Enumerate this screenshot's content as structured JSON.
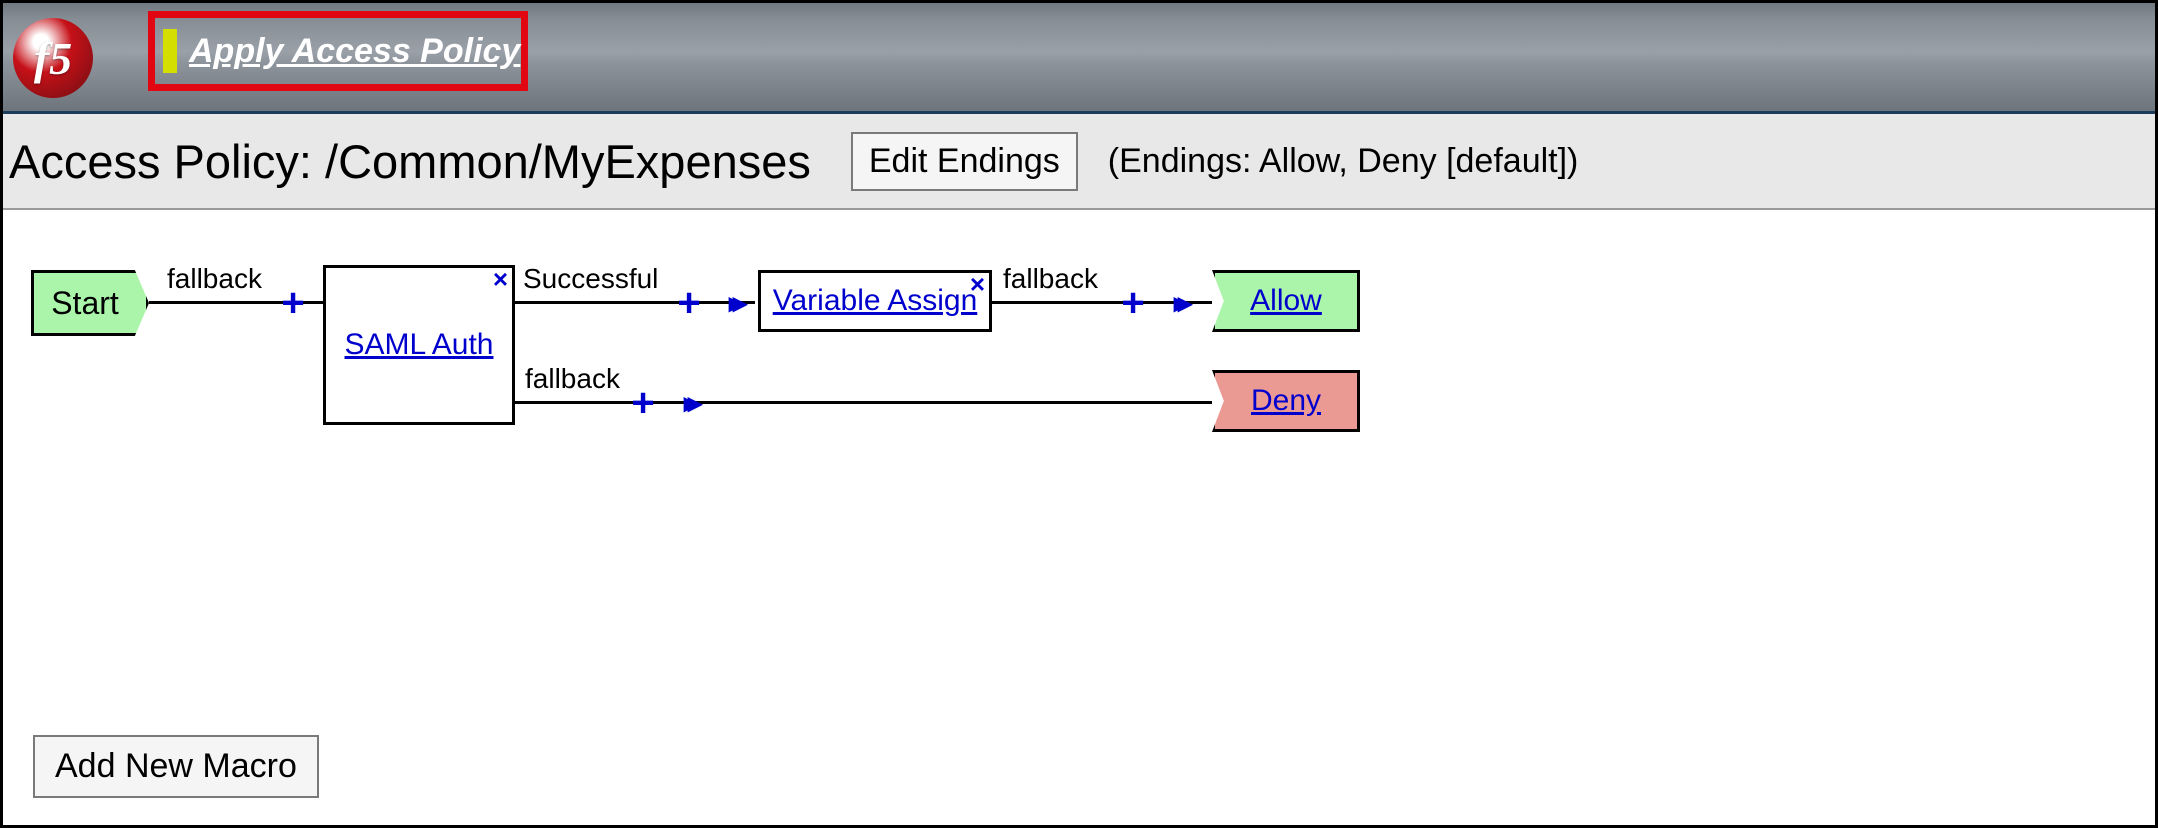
{
  "header": {
    "logo_text": "f5",
    "apply_link_label": "Apply Access Policy"
  },
  "subheader": {
    "title": "Access Policy: /Common/MyExpenses",
    "edit_endings_label": "Edit Endings",
    "endings_summary": "(Endings: Allow, Deny [default])"
  },
  "diagram": {
    "nodes": {
      "start": {
        "label": "Start"
      },
      "saml_auth": {
        "label": "SAML Auth"
      },
      "variable_assign": {
        "label": "Variable Assign"
      },
      "allow": {
        "label": "Allow"
      },
      "deny": {
        "label": "Deny"
      }
    },
    "edges": {
      "start_to_saml": {
        "label": "fallback"
      },
      "saml_success": {
        "label": "Successful"
      },
      "saml_fallback": {
        "label": "fallback"
      },
      "varassign_fallback": {
        "label": "fallback"
      }
    }
  },
  "buttons": {
    "add_new_macro": "Add New Macro"
  },
  "glyphs": {
    "plus": "+",
    "close": "×",
    "double_arrow": "▸▸"
  }
}
